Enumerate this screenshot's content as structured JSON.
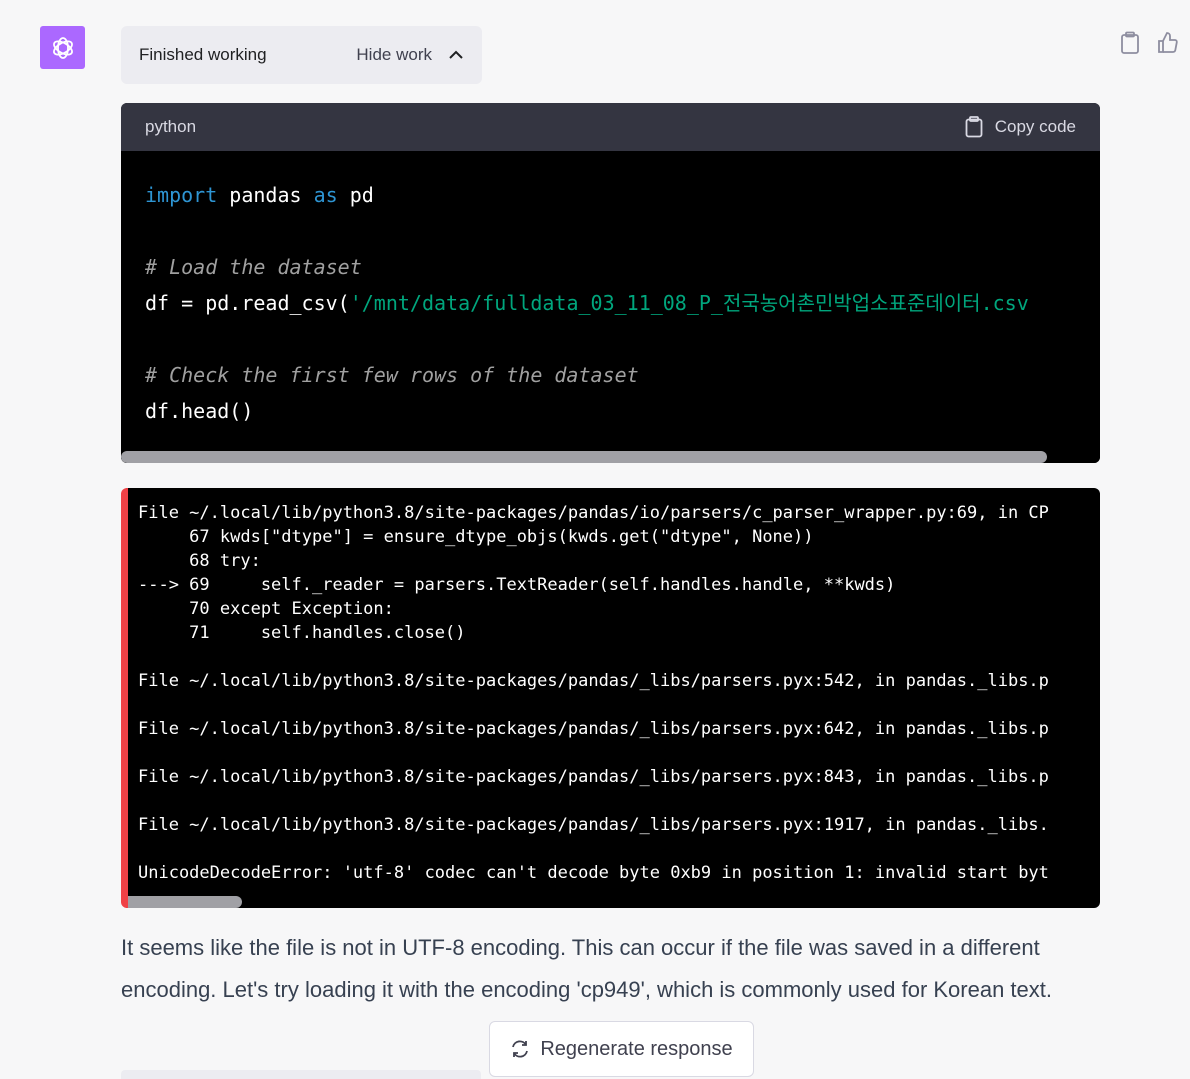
{
  "status": {
    "label": "Finished working",
    "hide_work_label": "Hide work"
  },
  "code_block": {
    "language": "python",
    "copy_label": "Copy code",
    "lines": [
      [
        {
          "t": "import",
          "c": "kw"
        },
        {
          "t": " pandas ",
          "c": ""
        },
        {
          "t": "as",
          "c": "kw"
        },
        {
          "t": " pd",
          "c": ""
        }
      ],
      [],
      [
        {
          "t": "# Load the dataset",
          "c": "cm"
        }
      ],
      [
        {
          "t": "df = pd.read_csv(",
          "c": ""
        },
        {
          "t": "'/mnt/data/fulldata_03_11_08_P_전국농어촌민박업소표준데이터.csv",
          "c": "str"
        }
      ],
      [],
      [
        {
          "t": "# Check the first few rows of the dataset",
          "c": "cm"
        }
      ],
      [
        {
          "t": "df.head()",
          "c": ""
        }
      ]
    ]
  },
  "error_output": {
    "lines": [
      "File ~/.local/lib/python3.8/site-packages/pandas/io/parsers/c_parser_wrapper.py:69, in CP",
      "     67 kwds[\"dtype\"] = ensure_dtype_objs(kwds.get(\"dtype\", None))",
      "     68 try:",
      "---> 69     self._reader = parsers.TextReader(self.handles.handle, **kwds)",
      "     70 except Exception:",
      "     71     self.handles.close()",
      "",
      "File ~/.local/lib/python3.8/site-packages/pandas/_libs/parsers.pyx:542, in pandas._libs.p",
      "",
      "File ~/.local/lib/python3.8/site-packages/pandas/_libs/parsers.pyx:642, in pandas._libs.p",
      "",
      "File ~/.local/lib/python3.8/site-packages/pandas/_libs/parsers.pyx:843, in pandas._libs.p",
      "",
      "File ~/.local/lib/python3.8/site-packages/pandas/_libs/parsers.pyx:1917, in pandas._libs.",
      "",
      "UnicodeDecodeError: 'utf-8' codec can't decode byte 0xb9 in position 1: invalid start byt"
    ]
  },
  "response": {
    "text": "It seems like the file is not in UTF-8 encoding. This can occur if the file was saved in a different encoding. Let's try loading it with the encoding 'cp949', which is commonly used for Korean text."
  },
  "regenerate": {
    "label": "Regenerate response"
  },
  "icons": {
    "avatar": "openai-logo-icon",
    "copy": "clipboard-icon",
    "like": "thumbs-up-icon",
    "collapse": "chevron-up-icon",
    "regenerate": "refresh-icon"
  },
  "colors": {
    "avatar_bg": "#ab68ff",
    "error_bar": "#ef4146",
    "keyword": "#2e95d3",
    "string": "#00a67d",
    "comment": "#a0a0a0"
  }
}
